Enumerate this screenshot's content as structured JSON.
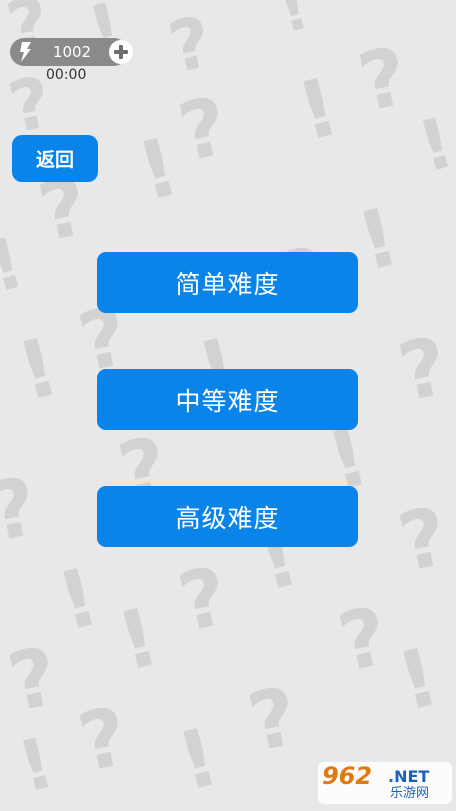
{
  "hud": {
    "energy_value": "1002",
    "timer": "00:00"
  },
  "nav": {
    "back_label": "返回"
  },
  "difficulty": {
    "easy_label": "简单难度",
    "medium_label": "中等难度",
    "hard_label": "高级难度"
  },
  "watermark": {
    "logo_text": "962",
    "net_text": ".NET",
    "site_text": "乐游网"
  },
  "colors": {
    "button_blue": "#0a84e8",
    "background": "#e8e8e8",
    "pattern": "#d2d2d2",
    "pill": "#8a8a8a"
  },
  "icons": {
    "energy": "lightning-bolt-icon",
    "add": "plus-circle-icon"
  }
}
